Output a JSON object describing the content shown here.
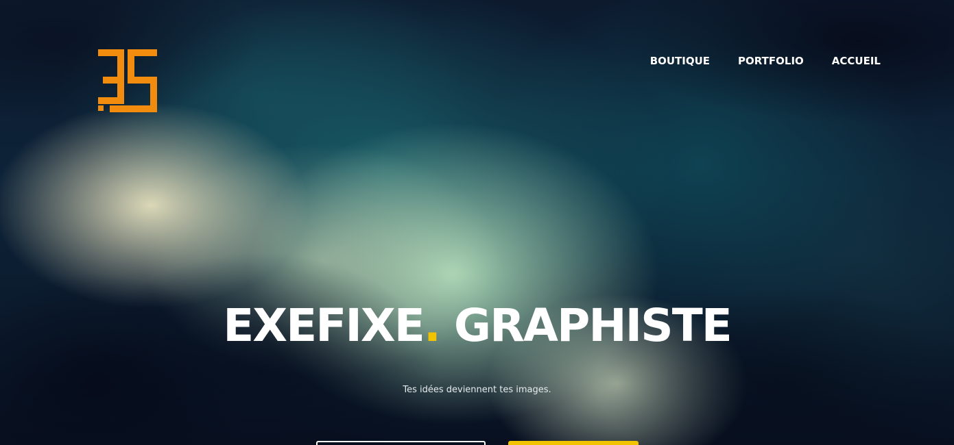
{
  "header": {
    "logo_alt": "3E5 logo",
    "nav": [
      {
        "label": "BOUTIQUE"
      },
      {
        "label": "PORTFOLIO"
      },
      {
        "label": "ACCUEIL"
      }
    ]
  },
  "hero": {
    "title_part1": "EXEFIXE",
    "title_dot": ".",
    "title_part2": " GRAPHISTE",
    "tagline": "Tes idées deviennent tes images.",
    "buttons": [
      {
        "label": "",
        "style": "outline"
      },
      {
        "label": "",
        "style": "filled"
      }
    ]
  },
  "colors": {
    "logo": "#f28c0f",
    "accent": "#f2c300",
    "text": "#ffffff"
  },
  "icons": [
    "logo-icon"
  ]
}
